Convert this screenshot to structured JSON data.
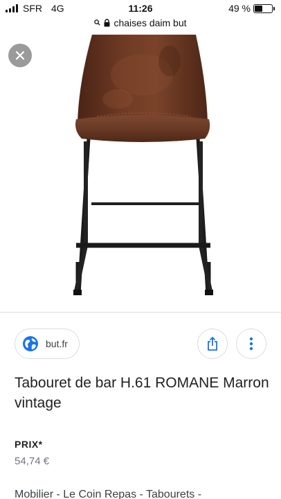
{
  "status_bar": {
    "carrier": "SFR",
    "network": "4G",
    "time": "11:26",
    "battery_percent": "49 %",
    "battery_level": 0.49
  },
  "browser": {
    "url_text": "chaises daim but"
  },
  "viewer": {
    "close_icon": "close-icon",
    "product_image": "brown suede bar stool with black metal legs"
  },
  "source": {
    "site": "but.fr",
    "icon": "globe-icon"
  },
  "actions": {
    "share_icon": "share-icon",
    "more_icon": "more-vertical-icon"
  },
  "product": {
    "title": "Tabouret de bar H.61 ROMANE Marron vintage",
    "price_label": "PRIX*",
    "price": "54,74 €",
    "category": "Mobilier - Le Coin Repas - Tabourets -"
  },
  "colors": {
    "link_blue": "#1a73e8",
    "close_gray": "#9a9a9a",
    "seat_brown": "#6b3a24"
  }
}
